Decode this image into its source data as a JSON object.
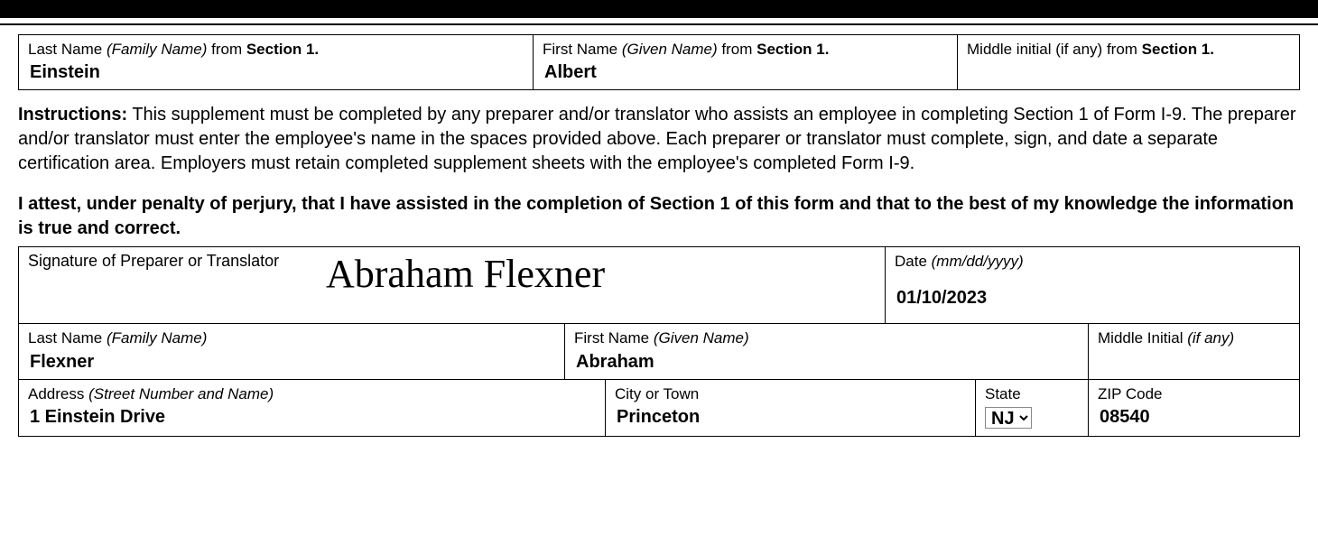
{
  "employee": {
    "last_label_pre": "Last Name ",
    "last_label_ital": "(Family Name)",
    "last_label_post": " from ",
    "last_label_bold": "Section 1.",
    "last_value": "Einstein",
    "first_label_pre": "First Name ",
    "first_label_ital": "(Given Name)",
    "first_label_post": " from ",
    "first_label_bold": "Section 1.",
    "first_value": "Albert",
    "mi_label_pre": "Middle initial (if any) from ",
    "mi_label_bold": "Section 1.",
    "mi_value": ""
  },
  "instructions": {
    "lead": "Instructions:",
    "body": "  This supplement must be completed by any preparer and/or translator who assists an employee in completing Section 1 of Form I-9. The preparer and/or translator must enter the employee's name in the spaces provided above.  Each preparer or translator must complete, sign, and date a separate certification area.  Employers must retain completed supplement sheets with the employee's completed Form I-9."
  },
  "attestation": "I attest, under penalty of perjury, that I have assisted in the completion of Section 1 of this form and that to the best of my knowledge the information is true and correct.",
  "preparer": {
    "sig_label": "Signature of Preparer or Translator",
    "signature": "Abraham Flexner",
    "date_label_pre": "Date ",
    "date_label_ital": "(mm/dd/yyyy)",
    "date_value": "01/10/2023",
    "last_label_pre": "Last Name ",
    "last_label_ital": "(Family Name)",
    "last_value": "Flexner",
    "first_label_pre": "First Name ",
    "first_label_ital": "(Given Name)",
    "first_value": "Abraham",
    "mi_label_pre": "Middle Initial ",
    "mi_label_ital": "(if any)",
    "mi_value": "",
    "addr_label_pre": "Address ",
    "addr_label_ital": "(Street Number and Name)",
    "addr_value": "1 Einstein Drive",
    "city_label": "City or Town",
    "city_value": "Princeton",
    "state_label": "State",
    "state_value": "NJ",
    "zip_label": "ZIP Code",
    "zip_value": "08540"
  }
}
